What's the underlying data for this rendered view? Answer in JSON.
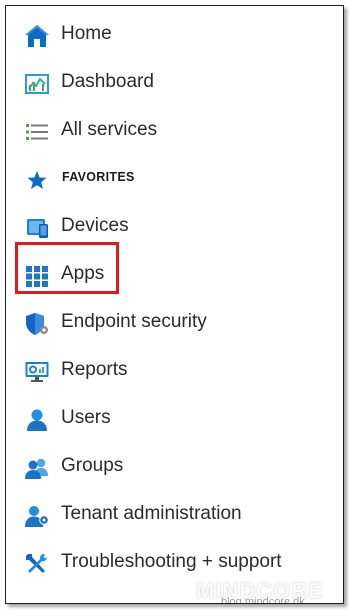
{
  "nav": {
    "home": "Home",
    "dashboard": "Dashboard",
    "all_services": "All services",
    "favorites_header": "FAVORITES",
    "devices": "Devices",
    "apps": "Apps",
    "endpoint_security": "Endpoint security",
    "reports": "Reports",
    "users": "Users",
    "groups": "Groups",
    "tenant_administration": "Tenant administration",
    "troubleshooting": "Troubleshooting + support"
  },
  "icons": {
    "home": "home-icon",
    "dashboard": "dashboard-icon",
    "all_services": "list-icon",
    "favorites": "star-icon",
    "devices": "devices-icon",
    "apps": "apps-grid-icon",
    "endpoint_security": "shield-gear-icon",
    "reports": "reports-monitor-icon",
    "users": "user-icon",
    "groups": "group-icon",
    "tenant_administration": "tenant-admin-icon",
    "troubleshooting": "wrench-screwdriver-icon"
  },
  "colors": {
    "accent_blue": "#0078d4",
    "highlight_red": "#e2191d",
    "text": "#2b2b2b"
  },
  "watermark": {
    "brand": "MINDCORE",
    "sub": "blog.mindcore.dk"
  }
}
